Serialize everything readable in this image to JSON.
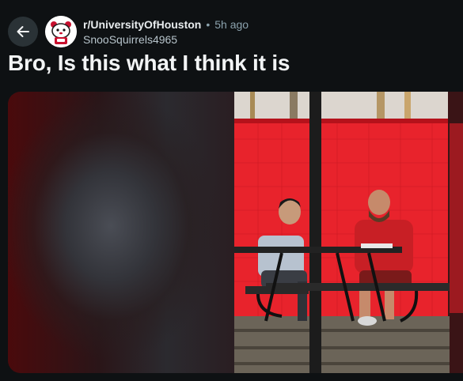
{
  "post": {
    "subreddit": "r/UniversityOfHouston",
    "separator": "•",
    "time_ago": "5h ago",
    "author": "SnooSquirrels4965",
    "title": "Bro, Is this what I think it is"
  },
  "colors": {
    "background": "#0e1113",
    "back_button": "#2a3236",
    "muted_text": "#8ba2ad",
    "photo_red": "#e8232c"
  },
  "icons": {
    "back": "arrow-left-icon",
    "subreddit_avatar": "cougar-mascot-icon"
  }
}
